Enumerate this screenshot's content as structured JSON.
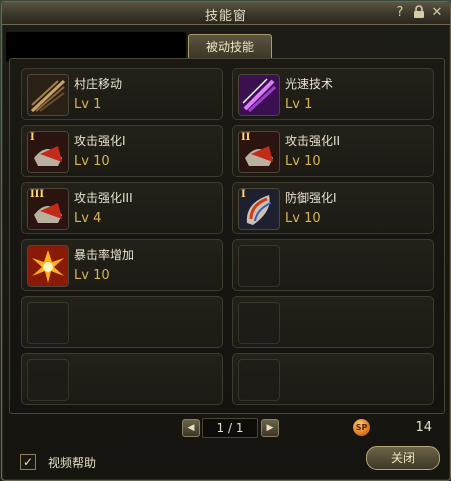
{
  "window": {
    "title": "技能窗"
  },
  "tabs": [
    {
      "label": "被动技能"
    }
  ],
  "skills": [
    {
      "name": "村庄移动",
      "level": "Lv 1"
    },
    {
      "name": "光速技术",
      "level": "Lv 1"
    },
    {
      "name": "攻击强化I",
      "level": "Lv 10"
    },
    {
      "name": "攻击强化II",
      "level": "Lv 10"
    },
    {
      "name": "攻击强化III",
      "level": "Lv 4"
    },
    {
      "name": "防御强化I",
      "level": "Lv 10"
    },
    {
      "name": "暴击率增加",
      "level": "Lv 10"
    }
  ],
  "icons": {
    "help": "?",
    "lock": "🔒",
    "close": "✕",
    "prev": "◀",
    "next": "▶",
    "check": "✓",
    "roman_I": "I",
    "roman_II": "II",
    "roman_III": "III"
  },
  "pager": {
    "text": "1 / 1"
  },
  "sp": {
    "badge": "SP",
    "value": "14"
  },
  "footer": {
    "video_help": "视频帮助",
    "close_label": "关闭"
  }
}
